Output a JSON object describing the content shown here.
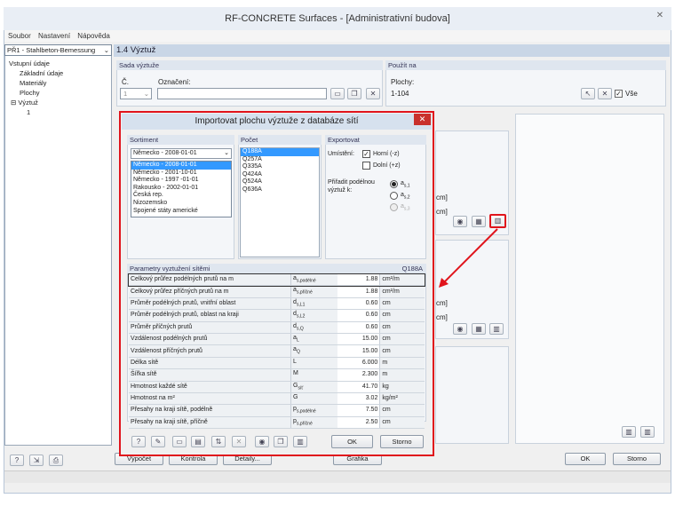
{
  "app": {
    "title": "RF-CONCRETE Surfaces - [Administrativní budova]"
  },
  "menu": [
    "Soubor",
    "Nastavení",
    "Nápověda"
  ],
  "nav": {
    "case": "PŘ1 - Stahlbeton-Bemessung",
    "items": [
      "Vstupní údaje",
      "Základní údaje",
      "Materiály",
      "Plochy",
      "Výztuž",
      "1"
    ]
  },
  "section": {
    "title": "1.4 Výztuž"
  },
  "set": {
    "header": "Sada výztuže",
    "no_label": "Č.",
    "no_value": "1",
    "name_label": "Označení:"
  },
  "use": {
    "header": "Použít na",
    "surfaces_label": "Plochy:",
    "surfaces_value": "1-104",
    "all_label": "Vše"
  },
  "bg": {
    "unit1": "cm]",
    "unit2": "cm]",
    "unit3": "cm]",
    "unit4": "cm]"
  },
  "main_buttons": {
    "calc": "Výpočet",
    "check": "Kontrola",
    "details": "Detaily...",
    "graphics": "Grafika",
    "ok": "OK",
    "cancel": "Storno"
  },
  "dialog": {
    "title": "Importovat plochu výztuže z databáze sítí",
    "assortment": {
      "header": "Sortiment",
      "selected": "Německo - 2008-01-01",
      "options": [
        "Německo - 2008-01-01",
        "Německo - 2001-10-01",
        "Německo - 1997 -01-01",
        "Rakousko - 2002-01-01",
        "Česká rep.",
        "Nizozemsko",
        "Spojené státy americké"
      ]
    },
    "count": {
      "header": "Počet",
      "items": [
        "Q188A",
        "Q257A",
        "Q335A",
        "Q424A",
        "Q524A",
        "Q636A"
      ]
    },
    "export": {
      "header": "Exportovat",
      "placement_label": "Umístění:",
      "top_label": "Horní (-z)",
      "bottom_label": "Dolní (+z)",
      "assign_label": "Přiřadit podélnou výztuž k:",
      "as1": "a",
      "as1_sub": "s,1",
      "as2": "a",
      "as2_sub": "s,2",
      "as3": "a",
      "as3_sub": "s,3"
    },
    "params": {
      "header": "Parametry vyztužení sítěmi",
      "mesh": "Q188A",
      "rows": [
        {
          "name": "Celkový průřez podélných prutů na m",
          "sym": "a",
          "sub": "s,podélné",
          "val": "1.88",
          "unit": "cm²/m"
        },
        {
          "name": "Celkový průřez příčných prutů na m",
          "sym": "a",
          "sub": "s,příčné",
          "val": "1.88",
          "unit": "cm²/m"
        },
        {
          "name": "Průměr podélných prutů, vnitřní oblast",
          "sym": "d",
          "sub": "s,L1",
          "val": "0.60",
          "unit": "cm"
        },
        {
          "name": "Průměr podélných prutů, oblast na kraji",
          "sym": "d",
          "sub": "s,L2",
          "val": "0.60",
          "unit": "cm"
        },
        {
          "name": "Průměr příčných prutů",
          "sym": "d",
          "sub": "s,Q",
          "val": "0.60",
          "unit": "cm"
        },
        {
          "name": "Vzdálenost podélných prutů",
          "sym": "a",
          "sub": "L",
          "val": "15.00",
          "unit": "cm"
        },
        {
          "name": "Vzdálenost příčných prutů",
          "sym": "a",
          "sub": "Q",
          "val": "15.00",
          "unit": "cm"
        },
        {
          "name": "Délka sítě",
          "sym": "L",
          "sub": "",
          "val": "6.000",
          "unit": "m"
        },
        {
          "name": "Šířka sítě",
          "sym": "M",
          "sub": "",
          "val": "2.300",
          "unit": "m"
        },
        {
          "name": "Hmotnost každé sítě",
          "sym": "G",
          "sub": "síť",
          "val": "41.70",
          "unit": "kg"
        },
        {
          "name": "Hmotnost na m²",
          "sym": "G",
          "sub": "",
          "val": "3.02",
          "unit": "kg/m²"
        },
        {
          "name": "Přesahy na kraji sítě, podélně",
          "sym": "p",
          "sub": "s,podélné",
          "val": "7.50",
          "unit": "cm"
        },
        {
          "name": "Přesahy na kraji sítě, příčně",
          "sym": "p",
          "sub": "s,příčné",
          "val": "2.50",
          "unit": "cm"
        }
      ]
    },
    "ok": "OK",
    "cancel": "Storno"
  }
}
